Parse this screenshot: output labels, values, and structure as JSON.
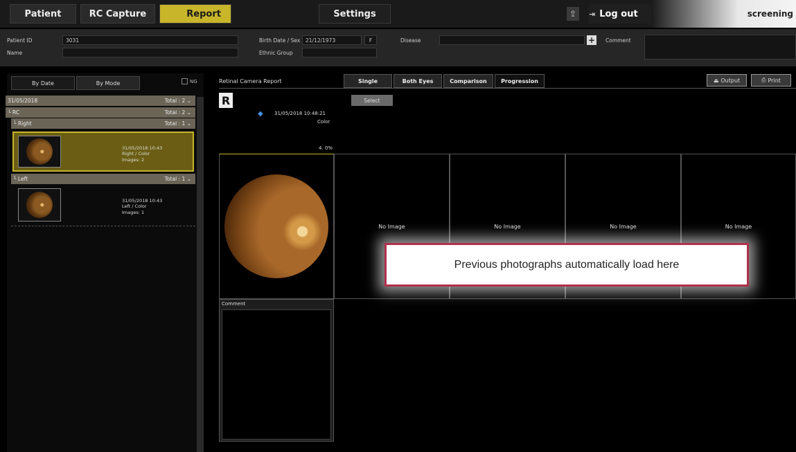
{
  "nav": {
    "tabs": [
      "Patient",
      "RC Capture",
      "Report",
      "Settings"
    ],
    "active_tab": "Report",
    "upload_icon": "upload-icon",
    "logout_label": "Log out",
    "screening_label": "screening"
  },
  "patient": {
    "id_label": "Patient ID",
    "id_value": "3031",
    "name_label": "Name",
    "name_value": "",
    "birth_label": "Birth Date / Sex",
    "birth_value": "21/12/1973",
    "sex_value": "F",
    "ethnic_label": "Ethnic Group",
    "ethnic_value": "",
    "disease_label": "Disease",
    "disease_value": "",
    "comment_label": "Comment",
    "comment_value": ""
  },
  "left": {
    "tabs": [
      "By Date",
      "By Mode"
    ],
    "ng_label": "NG",
    "date_group": {
      "label": "31/05/2018",
      "total": "Total : 2"
    },
    "mode_group": {
      "label": "RC",
      "total": "Total : 2"
    },
    "right_group": {
      "label": "Right",
      "total": "Total : 1"
    },
    "right_item": {
      "datetime": "31/05/2018 10:43",
      "desc": "Right / Color",
      "images": "Images: 2"
    },
    "left_group": {
      "label": "Left",
      "total": "Total : 1"
    },
    "left_item": {
      "datetime": "31/05/2018 10:43",
      "desc": "Left / Color",
      "images": "Images: 1"
    }
  },
  "report": {
    "title": "Retinal Camera Report",
    "tabs": [
      "Single",
      "Both Eyes",
      "Comparison",
      "Progression"
    ],
    "active_tab": "Progression",
    "output_label": "Output",
    "print_label": "Print",
    "eye_badge": "R",
    "select_label": "Select",
    "datetime": "31/05/2018 10:48:21",
    "mode": "Color",
    "percent": "4. 0%",
    "no_image": "No Image",
    "comment_label": "Comment"
  },
  "callout": "Previous photographs automatically load here",
  "colors": {
    "accent": "#c8b52a",
    "group_bar": "#6b6558",
    "callout_border": "#b0304a"
  }
}
